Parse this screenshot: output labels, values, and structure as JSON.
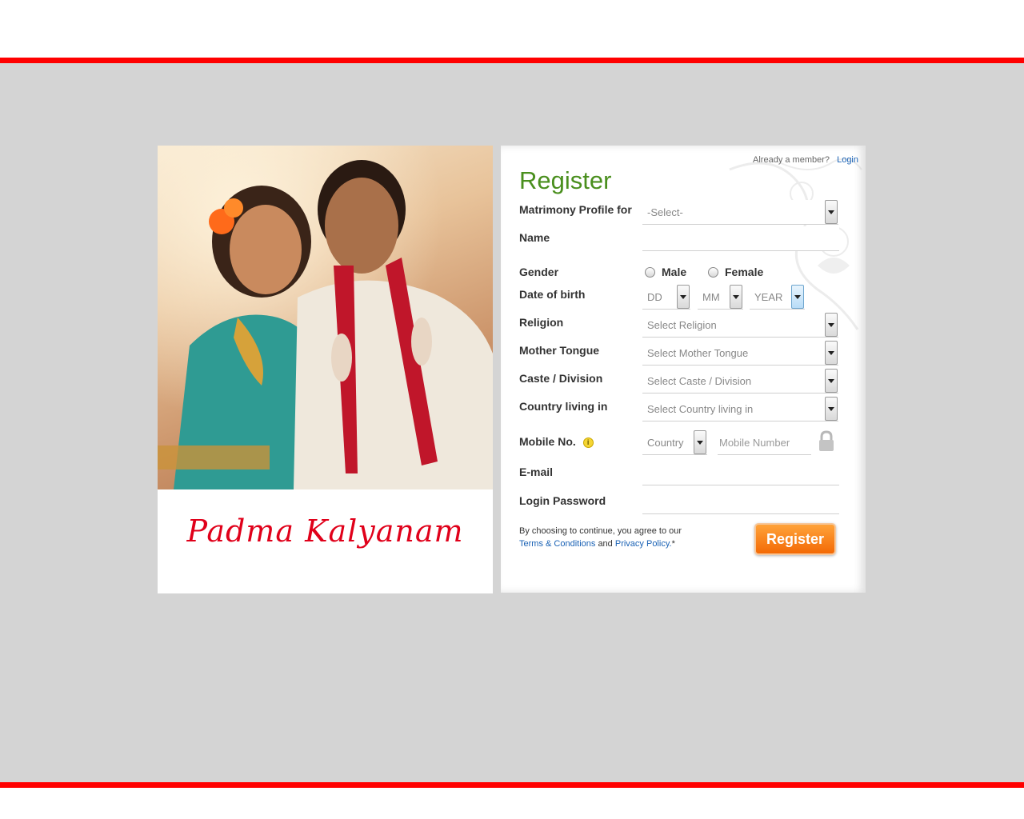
{
  "brand": {
    "name": "Padma Kalyanam"
  },
  "header": {
    "already_member": "Already a member?",
    "login_link": "Login"
  },
  "form": {
    "title": "Register",
    "labels": {
      "profile_for": "Matrimony Profile for",
      "name": "Name",
      "gender": "Gender",
      "dob": "Date of birth",
      "religion": "Religion",
      "mother_tongue": "Mother Tongue",
      "caste": "Caste / Division",
      "country": "Country living in",
      "mobile": "Mobile No.",
      "email": "E-mail",
      "password": "Login Password"
    },
    "profile_for_value": "-Select-",
    "gender_options": [
      "Male",
      "Female"
    ],
    "dob": {
      "day": "DD",
      "month": "MM",
      "year": "YEAR"
    },
    "religion_value": "Select Religion",
    "mother_tongue_value": "Select Mother Tongue",
    "caste_value": "Select Caste / Division",
    "country_value": "Select Country living in",
    "mobile_country_value": "Country",
    "mobile_placeholder": "Mobile Number",
    "terms_prefix": "By choosing to continue, you agree to our",
    "terms_link": "Terms & Conditions",
    "terms_and": "and",
    "privacy_link": "Privacy Policy.",
    "terms_suffix": "*",
    "submit_label": "Register"
  },
  "colors": {
    "accent_red": "#ff0000",
    "title_green": "#4a8f1e",
    "button_orange": "#f36a06",
    "link_blue": "#1a62b5"
  },
  "icons": [
    "info-icon",
    "lock-icon",
    "chevron-down-icon"
  ]
}
